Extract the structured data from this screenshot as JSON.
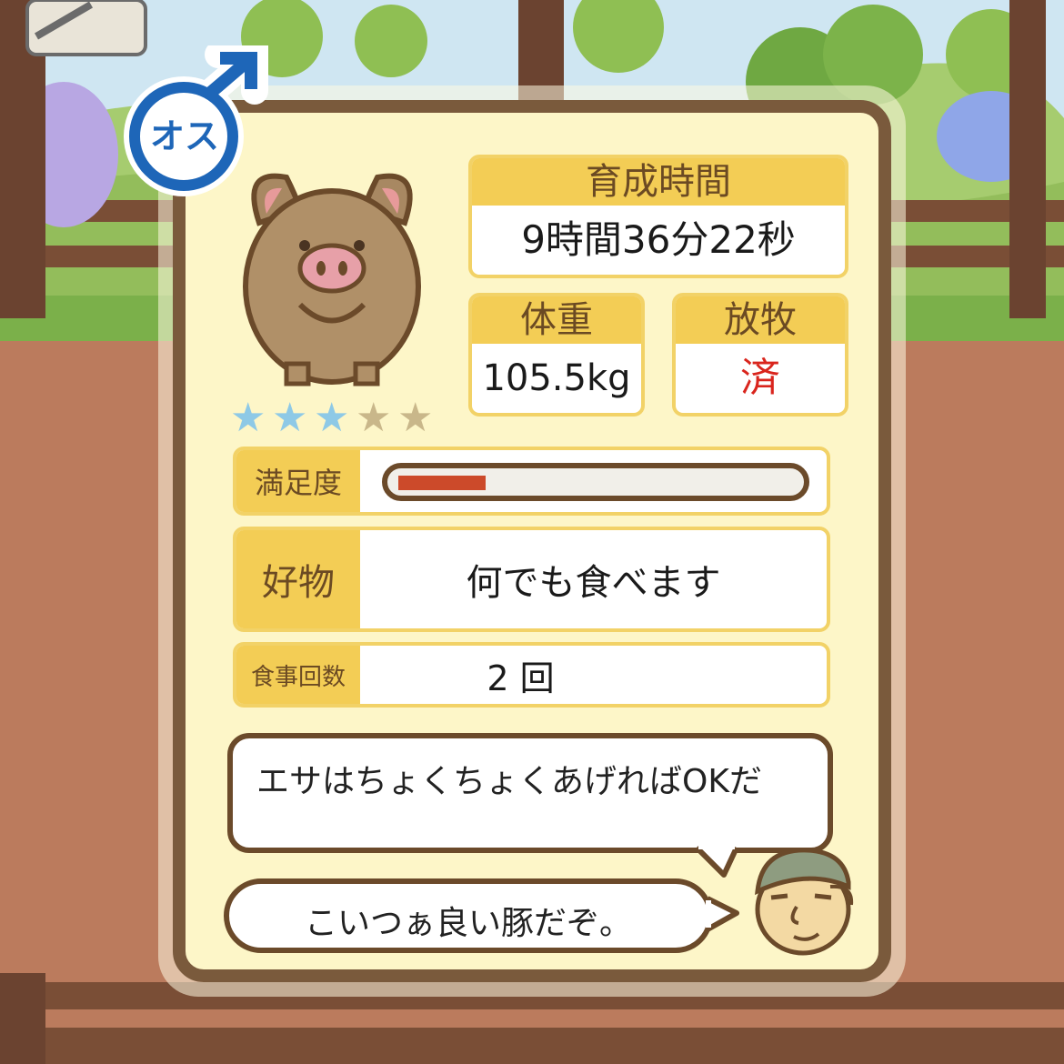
{
  "badge": {
    "gender_label": "オス",
    "gender_icon": "male-symbol-icon"
  },
  "pig": {
    "icon": "pig-icon",
    "rating": 3,
    "rating_max": 5
  },
  "stats": {
    "growth_time": {
      "label": "育成時間",
      "value": "9時間36分22秒"
    },
    "weight": {
      "label": "体重",
      "value": "105.5kg"
    },
    "grazing": {
      "label": "放牧",
      "value": "済"
    }
  },
  "satisfaction": {
    "label": "満足度",
    "level": 0.22
  },
  "favorite": {
    "label": "好物",
    "value": "何でも食べます"
  },
  "meals": {
    "label": "食事回数",
    "value": "2 回"
  },
  "farmer": {
    "icon": "farmer-face-icon",
    "tip": "エサはちょくちょくあげればOKだ",
    "comment": "こいつぁ良い豚だぞ。"
  },
  "colors": {
    "panel_bg": "#fdf6c8",
    "frame": "#7a5a3c",
    "header": "#f3cd55",
    "star_on": "#8ec9e6",
    "star_off": "#c9b78a",
    "bar_fill": "#cc4a2a",
    "grazing_value": "#d9251d",
    "badge_blue": "#1e66b8"
  }
}
